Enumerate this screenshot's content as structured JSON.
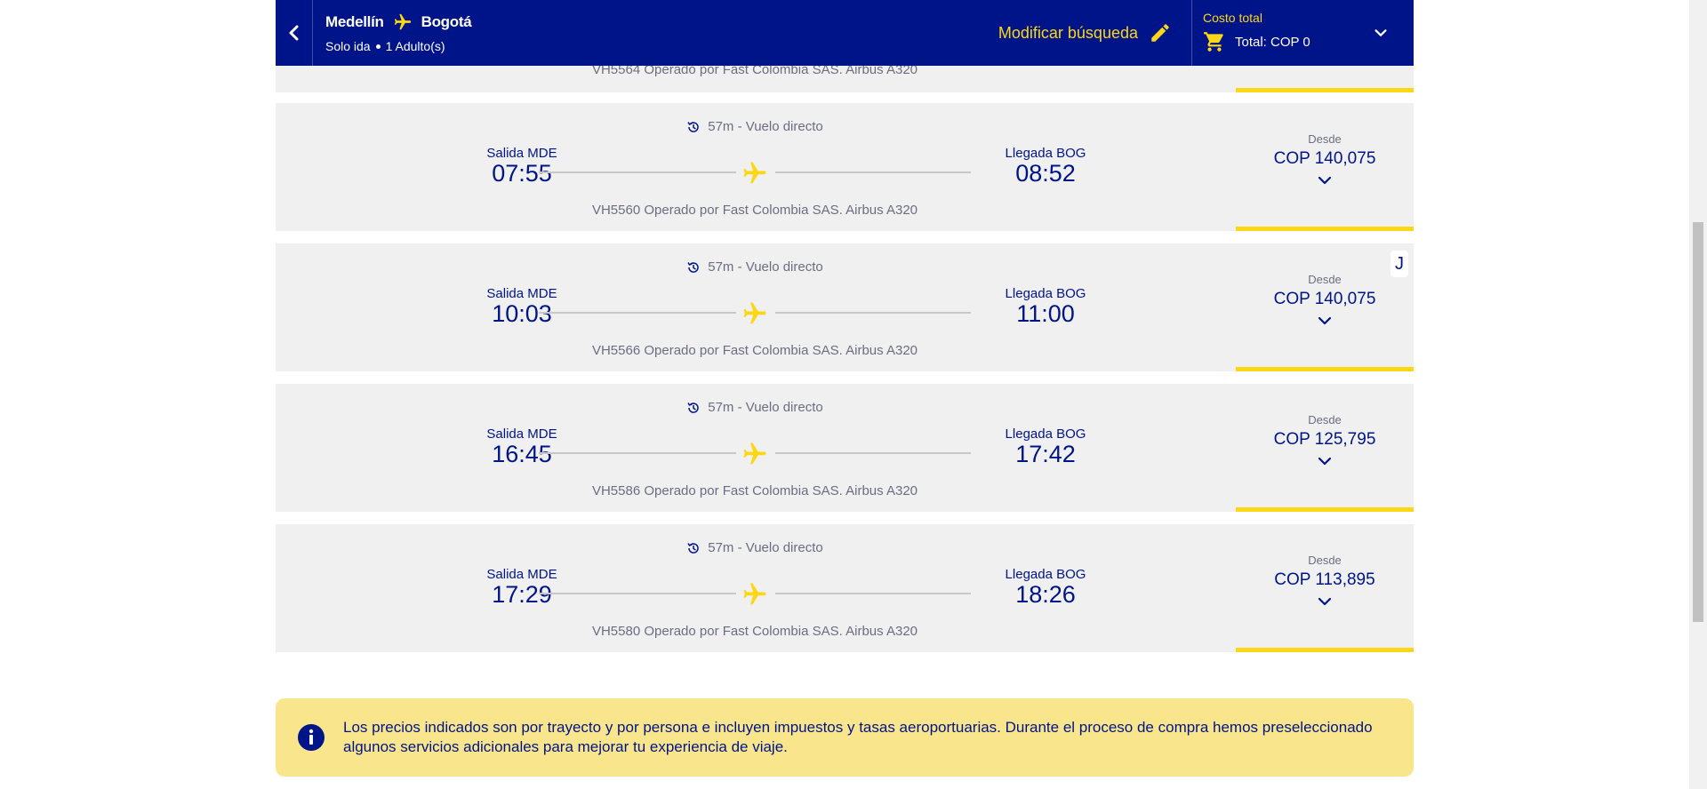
{
  "header": {
    "origin": "Medellín",
    "destination": "Bogotá",
    "trip_type": "Solo ida",
    "passengers": "1 Adulto(s)",
    "modify_label": "Modificar búsqueda",
    "cost_label": "Costo total",
    "total": "Total: COP 0"
  },
  "partial_card": {
    "operated": "VH5564 Operado por Fast Colombia SAS. Airbus A320"
  },
  "flights": [
    {
      "duration": "57m - Vuelo directo",
      "dep_label": "Salida MDE",
      "dep_time": "07:55",
      "arr_label": "Llegada BOG",
      "arr_time": "08:52",
      "operated": "VH5560 Operado por Fast Colombia SAS. Airbus A320",
      "desde": "Desde",
      "price": "COP 140,075"
    },
    {
      "duration": "57m - Vuelo directo",
      "dep_label": "Salida MDE",
      "dep_time": "10:03",
      "arr_label": "Llegada BOG",
      "arr_time": "11:00",
      "operated": "VH5566 Operado por Fast Colombia SAS. Airbus A320",
      "desde": "Desde",
      "price": "COP 140,075",
      "badge": "J"
    },
    {
      "duration": "57m - Vuelo directo",
      "dep_label": "Salida MDE",
      "dep_time": "16:45",
      "arr_label": "Llegada BOG",
      "arr_time": "17:42",
      "operated": "VH5586 Operado por Fast Colombia SAS. Airbus A320",
      "desde": "Desde",
      "price": "COP 125,795"
    },
    {
      "duration": "57m - Vuelo directo",
      "dep_label": "Salida MDE",
      "dep_time": "17:29",
      "arr_label": "Llegada BOG",
      "arr_time": "18:26",
      "operated": "VH5580 Operado por Fast Colombia SAS. Airbus A320",
      "desde": "Desde",
      "price": "COP 113,895"
    }
  ],
  "info": {
    "text": "Los precios indicados son por trayecto y por persona e incluyen impuestos y tasas aeroportuarias. Durante el proceso de compra hemos preseleccionado algunos servicios adicionales para mejorar tu experiencia de viaje."
  },
  "colors": {
    "brand_navy": "#001489",
    "accent_yellow": "#fcd716",
    "card_bg": "#f0f0f0",
    "info_bg": "#f9e68c"
  },
  "icons": [
    "back-icon",
    "plane-icon",
    "pencil-icon",
    "cart-icon",
    "chevron-down-icon",
    "clock-history-icon",
    "info-icon"
  ]
}
